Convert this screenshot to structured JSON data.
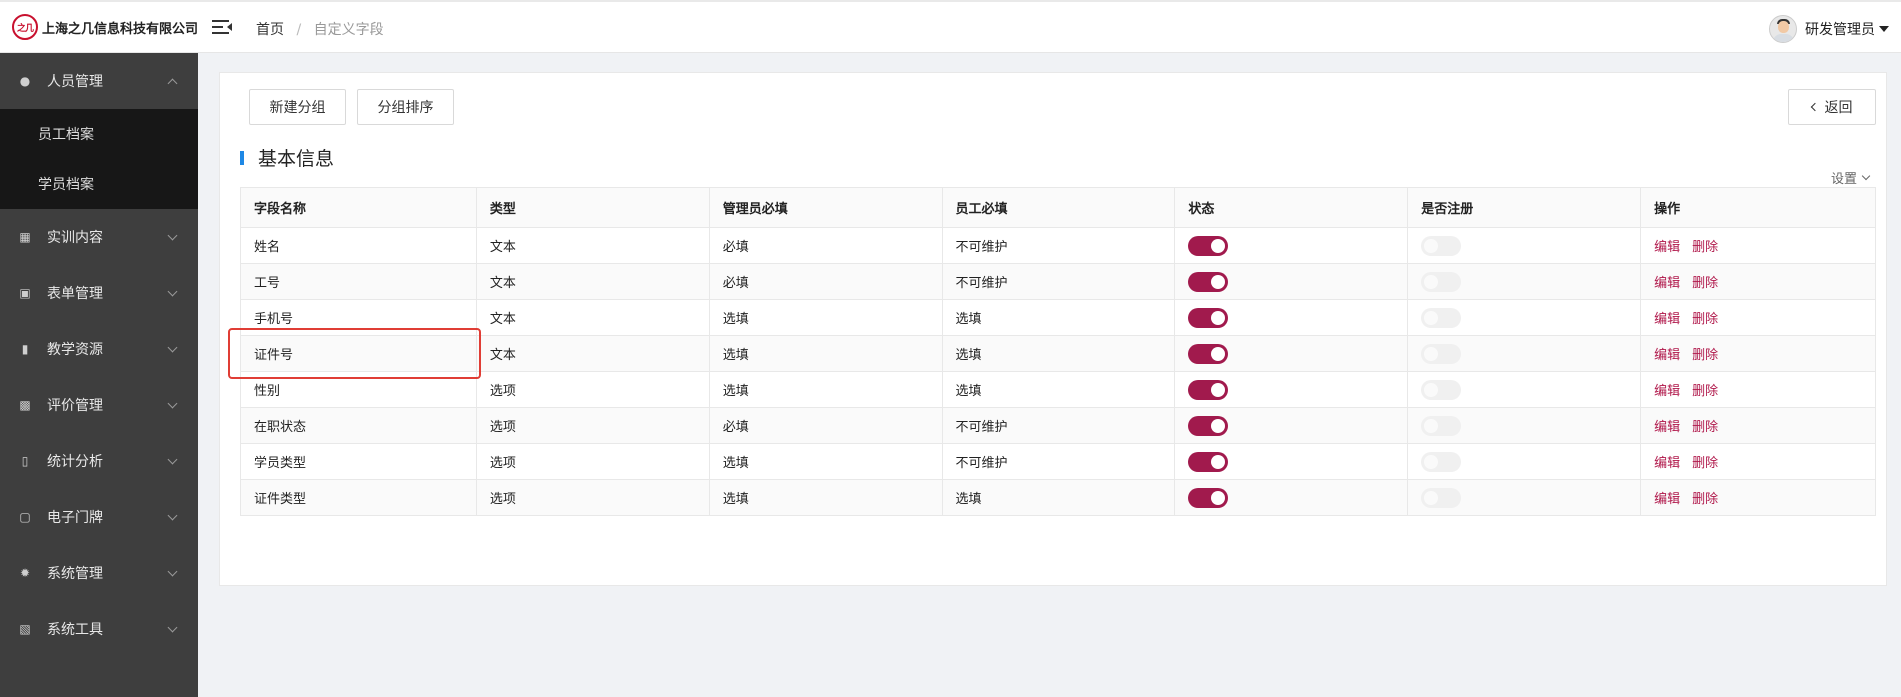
{
  "header": {
    "company": "上海之几信息科技有限公司",
    "logo_text": "之几",
    "breadcrumb": {
      "home": "首页",
      "sep": "/",
      "current": "自定义字段"
    },
    "user_name": "研发管理员"
  },
  "sidebar": {
    "items": [
      {
        "label": "人员管理",
        "icon": "person-icon",
        "expanded": true,
        "children": [
          {
            "label": "员工档案"
          },
          {
            "label": "学员档案"
          }
        ]
      },
      {
        "label": "实训内容",
        "icon": "training-icon"
      },
      {
        "label": "表单管理",
        "icon": "form-icon"
      },
      {
        "label": "教学资源",
        "icon": "book-icon"
      },
      {
        "label": "评价管理",
        "icon": "chart-box-icon"
      },
      {
        "label": "统计分析",
        "icon": "bar-chart-icon"
      },
      {
        "label": "电子门牌",
        "icon": "monitor-icon"
      },
      {
        "label": "系统管理",
        "icon": "gear-icon"
      },
      {
        "label": "系统工具",
        "icon": "toolbox-icon"
      }
    ]
  },
  "main": {
    "buttons": {
      "new_group": "新建分组",
      "group_sort": "分组排序",
      "back": "返回"
    },
    "section_title": "基本信息",
    "settings": "设置",
    "table": {
      "headers": [
        "字段名称",
        "类型",
        "管理员必填",
        "员工必填",
        "状态",
        "是否注册",
        "操作"
      ],
      "rows": [
        {
          "name": "姓名",
          "type": "文本",
          "admin_required": "必填",
          "staff_required": "不可维护",
          "status": true,
          "register": false
        },
        {
          "name": "工号",
          "type": "文本",
          "admin_required": "必填",
          "staff_required": "不可维护",
          "status": true,
          "register": false
        },
        {
          "name": "手机号",
          "type": "文本",
          "admin_required": "选填",
          "staff_required": "选填",
          "status": true,
          "register": false
        },
        {
          "name": "证件号",
          "type": "文本",
          "admin_required": "选填",
          "staff_required": "选填",
          "status": true,
          "register": false
        },
        {
          "name": "性别",
          "type": "选项",
          "admin_required": "选填",
          "staff_required": "选填",
          "status": true,
          "register": false
        },
        {
          "name": "在职状态",
          "type": "选项",
          "admin_required": "必填",
          "staff_required": "不可维护",
          "status": true,
          "register": false
        },
        {
          "name": "学员类型",
          "type": "选项",
          "admin_required": "选填",
          "staff_required": "不可维护",
          "status": true,
          "register": false
        },
        {
          "name": "证件类型",
          "type": "选项",
          "admin_required": "选填",
          "staff_required": "选填",
          "status": true,
          "register": false
        }
      ],
      "actions": {
        "edit": "编辑",
        "delete": "删除"
      }
    }
  },
  "colors": {
    "accent": "#a11a4d",
    "link": "#b0174a",
    "sidebar": "#3e3e3e",
    "highlight": "#e03d35",
    "section_bar": "#1e88e5"
  }
}
